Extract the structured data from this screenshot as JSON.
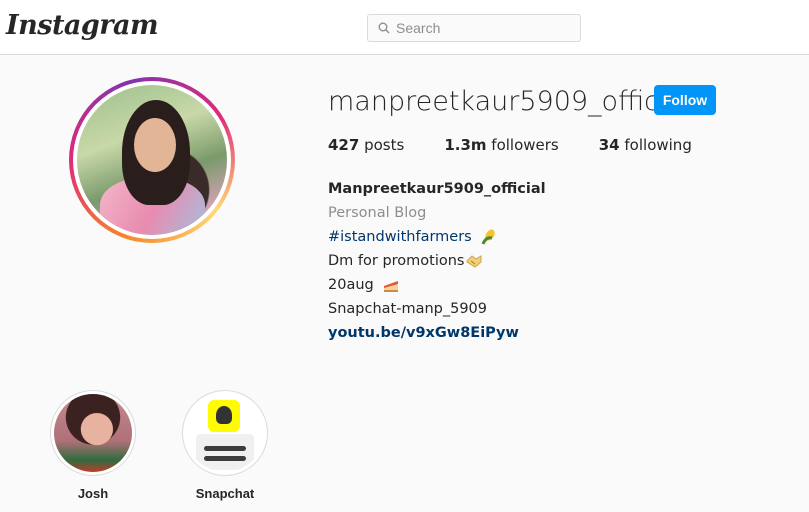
{
  "nav": {
    "logo": "Instagram",
    "search_placeholder": "Search"
  },
  "profile": {
    "username": "manpreetkaur5909_official",
    "follow_label": "Follow",
    "stats": {
      "posts_count": "427",
      "posts_label": "posts",
      "followers_count": "1.3m",
      "followers_label": "followers",
      "following_count": "34",
      "following_label": "following"
    },
    "bio": {
      "full_name": "Manpreetkaur5909_official",
      "category": "Personal Blog",
      "hashtag": "#istandwithfarmers",
      "line_promotions": "Dm for promotions",
      "line_birthday": "20aug",
      "line_snapchat": "Snapchat-manp_5909",
      "link": "youtu.be/v9xGw8EiPyw"
    }
  },
  "highlights": [
    {
      "label": "Josh"
    },
    {
      "label": "Snapchat"
    }
  ],
  "colors": {
    "accent": "#0095f6",
    "link": "#00376b",
    "secondary_text": "#8e8e8e"
  }
}
